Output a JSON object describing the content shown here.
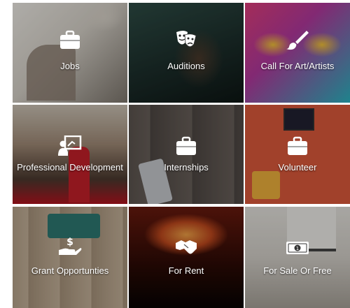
{
  "tiles": [
    {
      "label": "Jobs",
      "icon": "briefcase-icon"
    },
    {
      "label": "Auditions",
      "icon": "theater-masks-icon"
    },
    {
      "label": "Call For Art/Artists",
      "icon": "paint-brush-icon"
    },
    {
      "label": "Professional Development",
      "icon": "presentation-board-icon"
    },
    {
      "label": "Internships",
      "icon": "briefcase-icon"
    },
    {
      "label": "Volunteer",
      "icon": "briefcase-icon"
    },
    {
      "label": "Grant Opportunties",
      "icon": "hand-holding-dollar-icon"
    },
    {
      "label": "For Rent",
      "icon": "handshake-icon"
    },
    {
      "label": "For Sale Or Free",
      "icon": "money-bill-icon"
    }
  ]
}
